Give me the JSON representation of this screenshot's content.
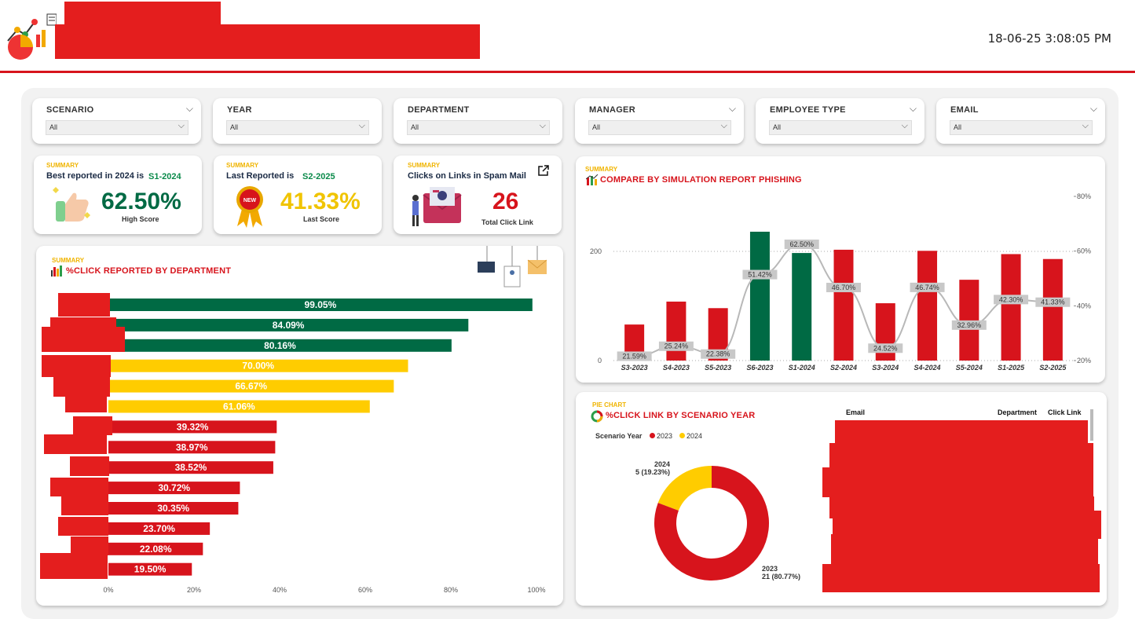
{
  "header": {
    "datetime": "18-06-25 3:08:05 PM",
    "colors": {
      "accent": "#d7141c",
      "green": "#006a44",
      "yellow": "#ffcc00",
      "red": "#d7141c"
    }
  },
  "filters": [
    {
      "title": "SCENARIO",
      "value": "All"
    },
    {
      "title": "YEAR",
      "value": "All"
    },
    {
      "title": "DEPARTMENT",
      "value": "All"
    },
    {
      "title": "MANAGER",
      "value": "All"
    },
    {
      "title": "EMPLOYEE TYPE",
      "value": "All"
    },
    {
      "title": "EMAIL",
      "value": "All"
    }
  ],
  "kpis": {
    "best": {
      "tag": "SUMMARY",
      "label": "Best reported in 2024 is",
      "highlight": "S1-2024",
      "value": "62.50%",
      "sub": "High Score"
    },
    "last": {
      "tag": "SUMMARY",
      "label": "Last Reported is",
      "highlight": "S2-2025",
      "value": "41.33%",
      "sub": "Last Score"
    },
    "clicks": {
      "tag": "SUMMARY",
      "label": "Clicks on Links in Spam Mail",
      "value": "26",
      "sub": "Total Click Link"
    }
  },
  "dept_chart": {
    "tag": "SUMMARY",
    "title": "%CLICK REPORTED BY DEPARTMENT"
  },
  "compare_chart": {
    "tag": "SUMMARY",
    "title": "COMPARE BY SIMULATION REPORT PHISHING"
  },
  "pie_chart": {
    "tag": "PIE CHART",
    "title": "%CLICK LINK BY SCENARIO YEAR",
    "legend_title": "Scenario Year",
    "legend": [
      "2023",
      "2024"
    ],
    "label_2024_year": "2024",
    "label_2024_val": "5 (19.23%)",
    "label_2023_year": "2023",
    "label_2023_val": "21 (80.77%)"
  },
  "table": {
    "columns": [
      "Email",
      "Department",
      "Click Link"
    ]
  },
  "chart_data": [
    {
      "type": "bar",
      "orientation": "horizontal",
      "title": "%CLICK REPORTED BY DEPARTMENT",
      "categories": [],
      "values": [
        99.05,
        84.09,
        80.16,
        70.0,
        66.67,
        61.06,
        39.32,
        38.97,
        38.52,
        30.72,
        30.35,
        23.7,
        22.08,
        19.5
      ],
      "labels": [
        "99.05%",
        "84.09%",
        "80.16%",
        "70.00%",
        "66.67%",
        "61.06%",
        "39.32%",
        "38.97%",
        "38.52%",
        "30.72%",
        "30.35%",
        "23.70%",
        "22.08%",
        "19.50%"
      ],
      "bar_colors": [
        "#006a44",
        "#006a44",
        "#006a44",
        "#ffcc00",
        "#ffcc00",
        "#ffcc00",
        "#d7141c",
        "#d7141c",
        "#d7141c",
        "#d7141c",
        "#d7141c",
        "#d7141c",
        "#d7141c",
        "#d7141c"
      ],
      "xlim": [
        0,
        100
      ],
      "xticks": [
        "0%",
        "20%",
        "40%",
        "60%",
        "80%",
        "100%"
      ],
      "grid": false
    },
    {
      "type": "bar",
      "combo": "bar+line",
      "title": "COMPARE BY SIMULATION REPORT PHISHING",
      "categories": [
        "S3-2023",
        "S4-2023",
        "S5-2023",
        "S6-2023",
        "S1-2024",
        "S2-2024",
        "S3-2024",
        "S4-2024",
        "S5-2024",
        "S1-2025",
        "S2-2025"
      ],
      "bar_values": [
        66,
        108,
        96,
        236,
        197,
        203,
        105,
        201,
        148,
        195,
        186
      ],
      "bar_colors": [
        "#d7141c",
        "#d7141c",
        "#d7141c",
        "#006a44",
        "#006a44",
        "#d7141c",
        "#d7141c",
        "#d7141c",
        "#d7141c",
        "#d7141c",
        "#d7141c"
      ],
      "line_values": [
        21.59,
        25.24,
        22.38,
        51.42,
        62.5,
        46.7,
        24.52,
        46.74,
        32.96,
        42.3,
        41.33
      ],
      "line_labels": [
        "21.59%",
        "25.24%",
        "22.38%",
        "51.42%",
        "62.50%",
        "46.70%",
        "24.52%",
        "46.74%",
        "32.96%",
        "42.30%",
        "41.33%"
      ],
      "ylim_left": [
        0,
        200
      ],
      "yticks_left": [
        "0",
        "200"
      ],
      "ylim_right": [
        20,
        80
      ],
      "yticks_right": [
        "20%",
        "40%",
        "60%",
        "80%"
      ],
      "grid": "dotted"
    },
    {
      "type": "pie",
      "donut": true,
      "title": "%CLICK LINK BY SCENARIO YEAR",
      "categories": [
        "2023",
        "2024"
      ],
      "values": [
        21,
        5
      ],
      "percent": [
        80.77,
        19.23
      ],
      "colors": [
        "#d7141c",
        "#ffcc00"
      ],
      "legend_placement": "top-left"
    }
  ]
}
